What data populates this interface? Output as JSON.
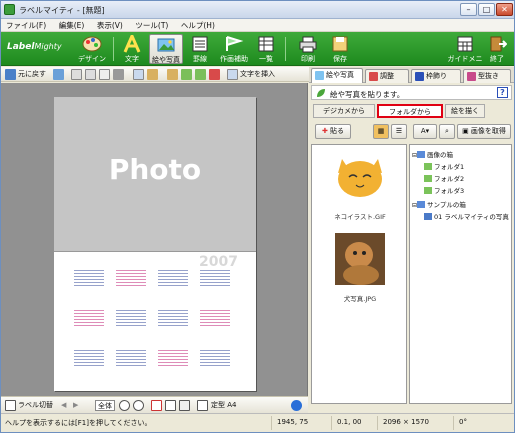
{
  "window": {
    "title": "ラベルマイティ - [無題]"
  },
  "menu": [
    "ファイル(F)",
    "編集(E)",
    "表示(V)",
    "ツール(T)",
    "ヘルプ(H)"
  ],
  "brand": {
    "logo_main": "Label",
    "logo_sub": "Mighty",
    "color_accent": "#2d9b2d"
  },
  "ribbon": {
    "left_items": [
      "デザイン",
      "文字",
      "絵や写真",
      "罫線",
      "作画補助",
      "一覧",
      "印刷",
      "保存"
    ],
    "right_items": [
      "ガイドメニュー",
      "終了"
    ]
  },
  "toolbar": {
    "undo_label": "元に戻す",
    "insert_label": "文字を挿入"
  },
  "canvas": {
    "photo_label": "Photo",
    "year": "2007"
  },
  "left_status": {
    "mode_label": "ラベル切替",
    "zoom_label": "全体",
    "size_label": "定型 A4"
  },
  "right_panel": {
    "tabs": [
      "絵や写真",
      "調整",
      "枠飾り",
      "型抜き"
    ],
    "heading": "絵や写真を貼ります。",
    "help": "?",
    "subtabs": [
      "デジカメから",
      "フォルダから",
      "絵を描く"
    ],
    "paste_button": "貼る",
    "search_button": "画像を取得",
    "thumbnails": [
      {
        "caption": "ネコイラスト.GIF"
      },
      {
        "caption": "犬写真.JPG"
      }
    ],
    "tree": {
      "items": [
        {
          "label": "画像の箱",
          "level": 0
        },
        {
          "label": "フォルダ1",
          "level": 1
        },
        {
          "label": "フォルダ2",
          "level": 1
        },
        {
          "label": "フォルダ3",
          "level": 1
        },
        {
          "label": "サンプルの箱",
          "level": 0
        },
        {
          "label": "01 ラベルマイティの写真",
          "level": 1
        }
      ]
    }
  },
  "statusbar": {
    "message": "ヘルプを表示するには[F1]を押してください。",
    "position": "1945, 75",
    "zoom": "0.1, 00",
    "size": "2096 × 1570",
    "angle": "0°"
  }
}
